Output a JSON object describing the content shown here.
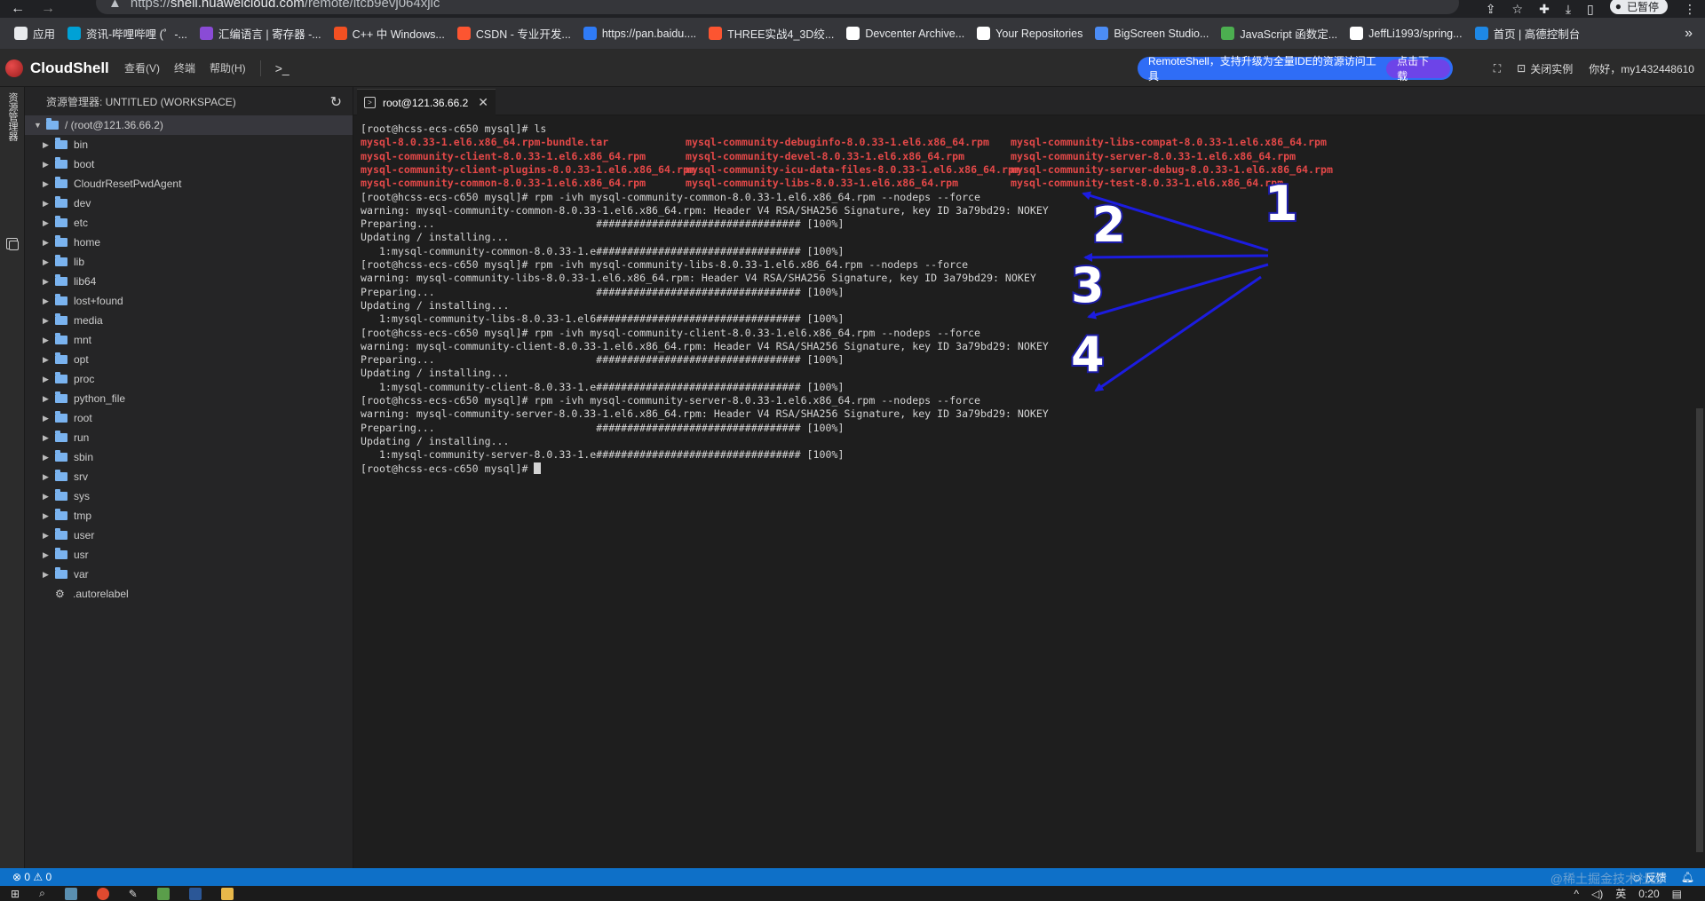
{
  "browser": {
    "url_prefix": "https://",
    "url_host": "shell.huaweicloud.com",
    "url_path": "/remote/itcb9evj064xjic",
    "pause_label": "已暂停"
  },
  "bookmarks": [
    {
      "label": "应用",
      "color": "#e8eaed",
      "icon": "apps-grid-icon"
    },
    {
      "label": "资讯-哔哩哔哩 (゜-...",
      "color": "#00a1d6",
      "icon": "bilibili-icon"
    },
    {
      "label": "汇编语言 | 寄存器 -...",
      "color": "#8a4bd6",
      "icon": "vs-icon"
    },
    {
      "label": "C++ 中 Windows...",
      "color": "#f25022",
      "icon": "microsoft-icon"
    },
    {
      "label": "CSDN - 专业开发...",
      "color": "#fc5531",
      "icon": "csdn-icon"
    },
    {
      "label": "https://pan.baidu....",
      "color": "#2f7bf6",
      "icon": "baidu-pan-icon"
    },
    {
      "label": "THREE实战4_3D绞...",
      "color": "#fc5531",
      "icon": "csdn-icon"
    },
    {
      "label": "Devcenter Archive...",
      "color": "#ffffff",
      "icon": "w-icon"
    },
    {
      "label": "Your Repositories",
      "color": "#ffffff",
      "icon": "github-icon"
    },
    {
      "label": "BigScreen Studio...",
      "color": "#4c8df6",
      "icon": "bigscreen-icon"
    },
    {
      "label": "JavaScript 函数定...",
      "color": "#4caf50",
      "icon": "js-icon"
    },
    {
      "label": "JeffLi1993/spring...",
      "color": "#ffffff",
      "icon": "github-icon"
    },
    {
      "label": "首页 | 高德控制台",
      "color": "#1e88e5",
      "icon": "amap-icon"
    }
  ],
  "app": {
    "name": "CloudShell",
    "menu": [
      "查看(V)",
      "终端",
      "帮助(H)"
    ],
    "terminal_icon": ">_",
    "banner_text": "RemoteShell，支持升级为全量IDE的资源访问工具",
    "banner_button": "点击下载",
    "close_instance": "关闭实例",
    "greeting": "你好，my1432448610"
  },
  "activity": {
    "explorer_label": "资源管理器"
  },
  "explorer": {
    "title": "资源管理器: UNTITLED (WORKSPACE)",
    "root": "/ (root@121.36.66.2)",
    "folders": [
      "bin",
      "boot",
      "CloudrResetPwdAgent",
      "dev",
      "etc",
      "home",
      "lib",
      "lib64",
      "lost+found",
      "media",
      "mnt",
      "opt",
      "proc",
      "python_file",
      "root",
      "run",
      "sbin",
      "srv",
      "sys",
      "tmp",
      "user",
      "usr",
      "var"
    ],
    "files": [
      ".autorelabel"
    ]
  },
  "tab": {
    "label": "root@121.36.66.2"
  },
  "terminal": {
    "prompt": "[root@hcss-ecs-c650 mysql]# ",
    "ls_cmd": "ls",
    "ls_files": [
      [
        "mysql-8.0.33-1.el6.x86_64.rpm-bundle.tar",
        "mysql-community-debuginfo-8.0.33-1.el6.x86_64.rpm",
        "mysql-community-libs-compat-8.0.33-1.el6.x86_64.rpm"
      ],
      [
        "mysql-community-client-8.0.33-1.el6.x86_64.rpm",
        "mysql-community-devel-8.0.33-1.el6.x86_64.rpm",
        "mysql-community-server-8.0.33-1.el6.x86_64.rpm"
      ],
      [
        "mysql-community-client-plugins-8.0.33-1.el6.x86_64.rpm",
        "mysql-community-icu-data-files-8.0.33-1.el6.x86_64.rpm",
        "mysql-community-server-debug-8.0.33-1.el6.x86_64.rpm"
      ],
      [
        "mysql-community-common-8.0.33-1.el6.x86_64.rpm",
        "mysql-community-libs-8.0.33-1.el6.x86_64.rpm",
        "mysql-community-test-8.0.33-1.el6.x86_64.rpm"
      ]
    ],
    "lines": [
      "[root@hcss-ecs-c650 mysql]# rpm -ivh mysql-community-common-8.0.33-1.el6.x86_64.rpm --nodeps --force",
      "warning: mysql-community-common-8.0.33-1.el6.x86_64.rpm: Header V4 RSA/SHA256 Signature, key ID 3a79bd29: NOKEY",
      "Preparing...                          ################################# [100%]",
      "Updating / installing...",
      "   1:mysql-community-common-8.0.33-1.e################################# [100%]",
      "[root@hcss-ecs-c650 mysql]# rpm -ivh mysql-community-libs-8.0.33-1.el6.x86_64.rpm --nodeps --force",
      "warning: mysql-community-libs-8.0.33-1.el6.x86_64.rpm: Header V4 RSA/SHA256 Signature, key ID 3a79bd29: NOKEY",
      "Preparing...                          ################################# [100%]",
      "Updating / installing...",
      "   1:mysql-community-libs-8.0.33-1.el6################################# [100%]",
      "[root@hcss-ecs-c650 mysql]# rpm -ivh mysql-community-client-8.0.33-1.el6.x86_64.rpm --nodeps --force",
      "warning: mysql-community-client-8.0.33-1.el6.x86_64.rpm: Header V4 RSA/SHA256 Signature, key ID 3a79bd29: NOKEY",
      "Preparing...                          ################################# [100%]",
      "Updating / installing...",
      "   1:mysql-community-client-8.0.33-1.e################################# [100%]",
      "[root@hcss-ecs-c650 mysql]# rpm -ivh mysql-community-server-8.0.33-1.el6.x86_64.rpm --nodeps --force",
      "warning: mysql-community-server-8.0.33-1.el6.x86_64.rpm: Header V4 RSA/SHA256 Signature, key ID 3a79bd29: NOKEY",
      "Preparing...                          ################################# [100%]",
      "Updating / installing...",
      "   1:mysql-community-server-8.0.33-1.e################################# [100%]"
    ],
    "final_prompt": "[root@hcss-ecs-c650 mysql]# "
  },
  "annotations": {
    "labels": [
      "1",
      "2",
      "3",
      "4"
    ],
    "arrow_color": "#1c1ce0"
  },
  "status": {
    "problems": "⊗ 0 ⚠ 0",
    "feedback": "反馈"
  },
  "taskbar": {
    "ime": "英",
    "time": "0:20"
  },
  "watermark": "@稀土掘金技术社区"
}
